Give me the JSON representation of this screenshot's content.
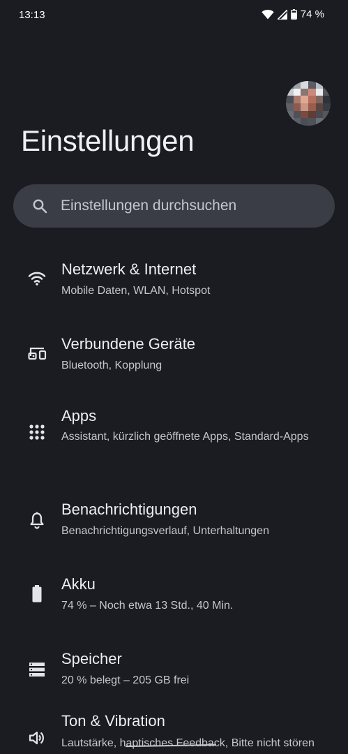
{
  "status_bar": {
    "time": "13:13",
    "battery_text": "74 %",
    "icons": [
      "wifi-icon",
      "signal-icon",
      "battery-icon"
    ]
  },
  "header": {
    "title": "Einstellungen"
  },
  "search": {
    "placeholder": "Einstellungen durchsuchen",
    "icon": "search-icon"
  },
  "colors": {
    "background": "#1a1c22",
    "search_background": "#3a3d45",
    "text_primary": "#eeedf2",
    "text_secondary": "#c7c6cc"
  },
  "settings": {
    "items": [
      {
        "icon": "wifi-icon",
        "title": "Netzwerk & Internet",
        "subtitle": "Mobile Daten, WLAN, Hotspot"
      },
      {
        "icon": "connected-devices-icon",
        "title": "Verbundene Geräte",
        "subtitle": "Bluetooth, Kopplung"
      },
      {
        "icon": "apps-grid-icon",
        "title": "Apps",
        "subtitle": "Assistant, kürzlich geöffnete Apps, Standard-Apps"
      },
      {
        "icon": "bell-icon",
        "title": "Benachrichtigungen",
        "subtitle": "Benachrichtigungsverlauf, Unterhaltungen"
      },
      {
        "icon": "battery-icon",
        "title": "Akku",
        "subtitle": "74 % – Noch etwa 13 Std., 40 Min."
      },
      {
        "icon": "storage-icon",
        "title": "Speicher",
        "subtitle": "20 % belegt – 205 GB frei"
      },
      {
        "icon": "volume-icon",
        "title": "Ton & Vibration",
        "subtitle": "Lautstärke, haptisches Feedback, Bitte nicht stören"
      }
    ]
  }
}
